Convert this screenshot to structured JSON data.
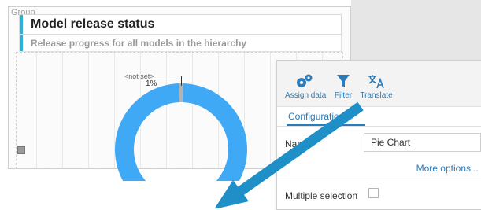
{
  "group": {
    "label": "Group"
  },
  "header": {
    "title": "Model release status",
    "subtitle": "Release progress for all models in the hierarchy"
  },
  "pie": {
    "slice_label": "<not set>",
    "slice_pct": "1%",
    "colors": {
      "main": "#3fa9f5",
      "slice": "#b3b3b3"
    }
  },
  "chart_data": {
    "type": "pie",
    "categories": [
      "<not set>",
      ""
    ],
    "values": [
      1,
      99
    ]
  },
  "panel": {
    "toolbar": {
      "assign_label": "Assign data",
      "filter_label": "Filter",
      "translate_label": "Translate"
    },
    "tab_label": "Configuration",
    "name_label": "Name",
    "name_value": "Pie Chart",
    "more_label": "More options...",
    "multi_label": "Multiple selection"
  },
  "colors": {
    "accent": "#2b7bb9",
    "title_bar": "#31b0d5",
    "arrow": "#1e8fc7"
  }
}
